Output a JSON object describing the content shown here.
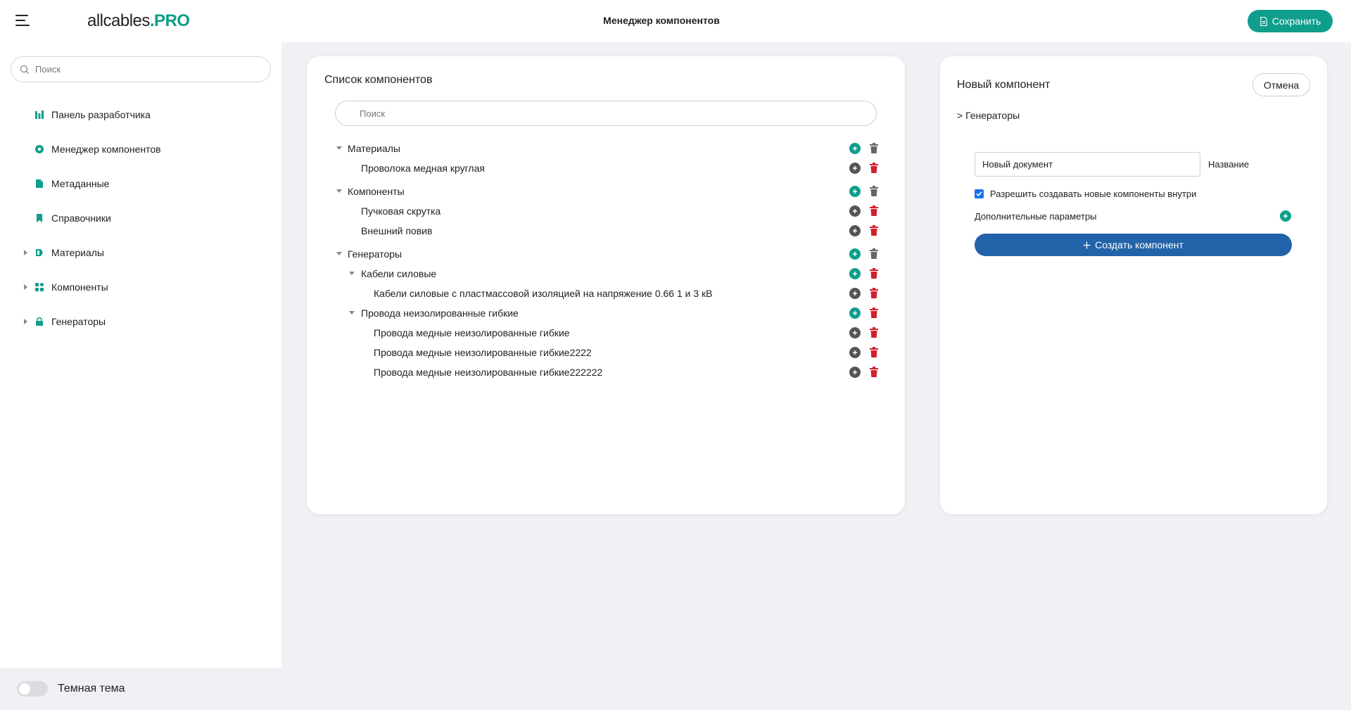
{
  "app": {
    "logo_main": "allcables",
    "logo_accent": ".PRO",
    "title": "Менеджер компонентов",
    "save_label": "Сохранить",
    "accent_color": "#0e9e8b"
  },
  "sidebar": {
    "search_placeholder": "Поиск",
    "items": [
      {
        "label": "Панель разработчика",
        "icon": "chart-bars-icon",
        "expandable": false
      },
      {
        "label": "Менеджер компонентов",
        "icon": "gear-icon",
        "expandable": false
      },
      {
        "label": "Метаданные",
        "icon": "document-icon",
        "expandable": false
      },
      {
        "label": "Справочники",
        "icon": "bookmark-icon",
        "expandable": false
      },
      {
        "label": "Материалы",
        "icon": "material-icon",
        "expandable": true
      },
      {
        "label": "Компоненты",
        "icon": "grid-icon",
        "expandable": true
      },
      {
        "label": "Генераторы",
        "icon": "lock-icon",
        "expandable": true
      }
    ],
    "theme_toggle_label": "Темная тема",
    "theme_toggle_on": false
  },
  "components_list": {
    "title": "Список компонентов",
    "search_placeholder": "Поиск",
    "tree": [
      {
        "label": "Материалы",
        "level": 0,
        "expanded": true
      },
      {
        "label": "Проволока медная круглая",
        "level": 1
      },
      {
        "label": "Компоненты",
        "level": 0,
        "expanded": true
      },
      {
        "label": "Пучковая скрутка",
        "level": 1
      },
      {
        "label": "Внешний повив",
        "level": 1
      },
      {
        "label": "Генераторы",
        "level": 0,
        "expanded": true
      },
      {
        "label": "Кабели силовые",
        "level": 1,
        "expanded": true
      },
      {
        "label": "Кабели силовые с пластмассовой изоляцией на напряжение 0.66 1 и 3 кВ",
        "level": 2
      },
      {
        "label": "Провода неизолированные гибкие",
        "level": 1,
        "expanded": true
      },
      {
        "label": "Провода медные неизолированные гибкие",
        "level": 2
      },
      {
        "label": "Провода медные неизолированные гибкие2222",
        "level": 2
      },
      {
        "label": "Провода медные неизолированные гибкие222222",
        "level": 2
      }
    ]
  },
  "new_component": {
    "title": "Новый компонент",
    "cancel_label": "Отмена",
    "breadcrumb": "> Генераторы",
    "name_value": "Новый документ",
    "name_label": "Название",
    "allow_children_label": "Разрешить создавать новые компоненты внутри",
    "allow_children_checked": true,
    "extra_params_label": "Дополнительные параметры",
    "create_label": "Создать компонент",
    "create_color": "#2262a8"
  }
}
